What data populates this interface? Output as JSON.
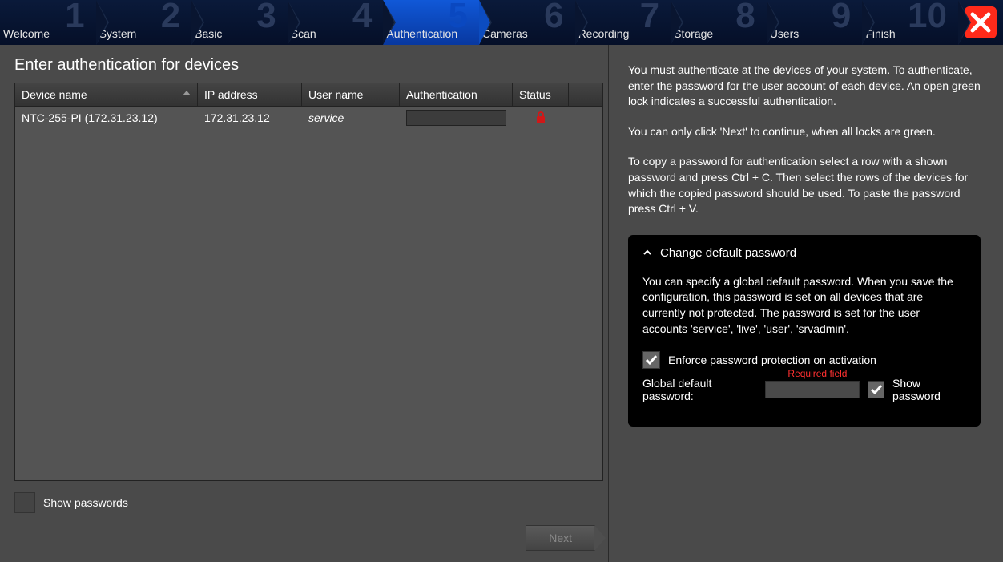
{
  "wizard": {
    "steps": [
      {
        "num": "1",
        "label": "Welcome"
      },
      {
        "num": "2",
        "label": "System"
      },
      {
        "num": "3",
        "label": "Basic"
      },
      {
        "num": "4",
        "label": "Scan"
      },
      {
        "num": "5",
        "label": "Authentication"
      },
      {
        "num": "6",
        "label": "Cameras"
      },
      {
        "num": "7",
        "label": "Recording"
      },
      {
        "num": "8",
        "label": "Storage"
      },
      {
        "num": "9",
        "label": "Users"
      },
      {
        "num": "10",
        "label": "Finish"
      }
    ],
    "active_index": 4
  },
  "page_title": "Enter authentication for devices",
  "table": {
    "columns": {
      "device_name": "Device name",
      "ip_address": "IP address",
      "user_name": "User name",
      "authentication": "Authentication",
      "status": "Status"
    },
    "rows": [
      {
        "device_name": "NTC-255-PI (172.31.23.12)",
        "ip_address": "172.31.23.12",
        "user_name": "service",
        "authentication": "",
        "status": "locked"
      }
    ]
  },
  "show_passwords_label": "Show passwords",
  "next_label": "Next",
  "help": {
    "p1": "You must authenticate at the devices of your system. To authenticate, enter the password for the user account of each device. An open green lock indicates a successful authentication.",
    "p2": "You can only click 'Next' to continue, when all locks are green.",
    "p3": "To copy a password for authentication select a row with a shown password and press Ctrl + C. Then select the rows of the devices for which the copied password should be used. To paste the password press Ctrl + V."
  },
  "accordion": {
    "title": "Change default password",
    "body": "You can specify a global default password. When you save the configuration, this password is set on all devices that are currently not protected. The password is set for the user accounts 'service', 'live', 'user', 'srvadmin'.",
    "enforce_label": "Enforce password protection on activation",
    "gdp_label": "Global default password:",
    "required_label": "Required field",
    "show_password_label": "Show password"
  }
}
